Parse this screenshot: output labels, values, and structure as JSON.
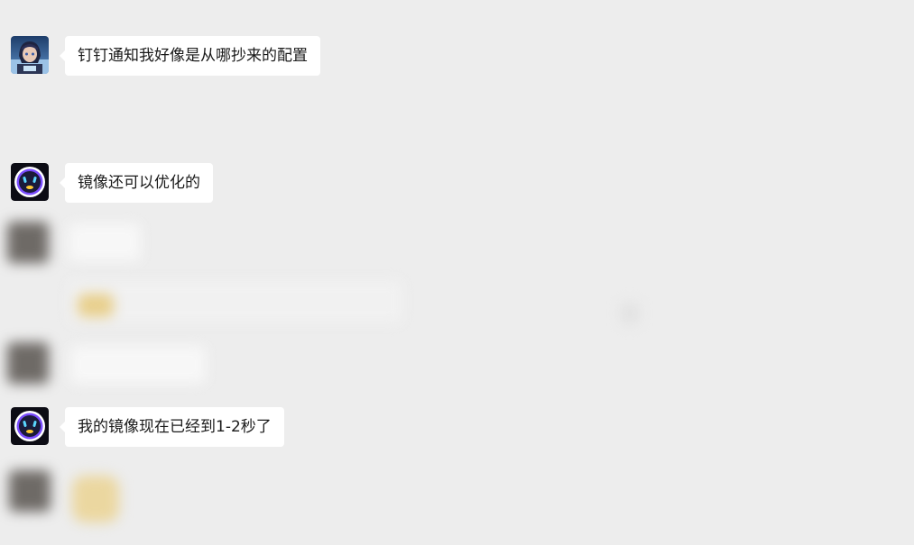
{
  "messages": [
    {
      "sender": "user-anime",
      "text": "钉钉通知我好像是从哪抄来的配置"
    },
    {
      "sender": "robot",
      "text": "镜像还可以优化的"
    },
    {
      "sender": "robot",
      "text": "我的镜像现在已经到1-2秒了"
    }
  ],
  "colors": {
    "background": "#ededed",
    "bubble": "#ffffff",
    "robot_ring": "#7a4dff",
    "robot_dark": "#1b1b3a"
  }
}
